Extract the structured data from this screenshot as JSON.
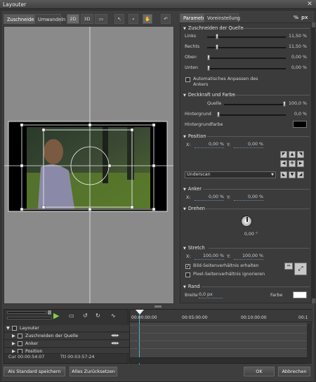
{
  "window": {
    "title": "Layouter"
  },
  "top_tabs": [
    "Zuschneiden",
    "Umwandeln"
  ],
  "toolbar": {
    "b2d": "2D",
    "b3d": "3D"
  },
  "panel_tabs": [
    "Parameter",
    "Voreinstellung"
  ],
  "units": {
    "percent": "%",
    "px": "px"
  },
  "crop": {
    "title": "Zuschneiden der Quelle",
    "rows": [
      {
        "label": "Links",
        "value": "11,50 %",
        "level": 0.115
      },
      {
        "label": "Rechts",
        "value": "11,50 %",
        "level": 0.115
      },
      {
        "label": "Oben",
        "value": "0,00 %",
        "level": 0.0
      },
      {
        "label": "Unten",
        "value": "0,00 %",
        "level": 0.0
      }
    ],
    "auto_adjust": "Automatisches Anpassen des Ankers"
  },
  "opacity": {
    "title": "Deckkraft und Farbe",
    "source_label": "Quelle",
    "source_value": "100,0 %",
    "source_level": 1.0,
    "bg_label": "Hintergrund",
    "bg_value": "0,0 %",
    "bg_level": 0.0,
    "bgcolor_label": "Hintergrundfarbe",
    "bgcolor": "#000000"
  },
  "position": {
    "title": "Position",
    "x_label": "X:",
    "x_value": "0,00 %",
    "y_label": "Y:",
    "y_value": "0,00 %",
    "select_value": "Underscan"
  },
  "anchor": {
    "title": "Anker",
    "x_label": "X:",
    "x_value": "0,00 %",
    "y_label": "Y:",
    "y_value": "0,00 %"
  },
  "rotate": {
    "title": "Drehen",
    "value": "0,00 °"
  },
  "stretch": {
    "title": "Stretch",
    "x_label": "X:",
    "x_value": "100,00 %",
    "y_label": "Y:",
    "y_value": "100,00 %",
    "keep_aspect": "Bild-Seitenverhältnis erhalten",
    "ignore_pixel": "Pixel-Seitenverhältnis ignorieren"
  },
  "border": {
    "title": "Rand",
    "width_label": "Breite",
    "width_value": "0,0 px",
    "color_label": "Farbe",
    "color": "#ffffff"
  },
  "timeline": {
    "tracks": [
      "Layouter",
      "Zuschneiden der Quelle",
      "Anker",
      "Position"
    ],
    "cur": "Cur 00:00:54:07",
    "ttl": "Ttl 00:03:57:24",
    "ruler": [
      "00:00:00:00",
      "00:05:00:00",
      "00:10:00:00",
      "00:1"
    ]
  },
  "footer": {
    "save_default": "Als Standard speichern",
    "reset_all": "Alles Zurücksetzen",
    "ok": "OK",
    "cancel": "Abbrechen"
  }
}
